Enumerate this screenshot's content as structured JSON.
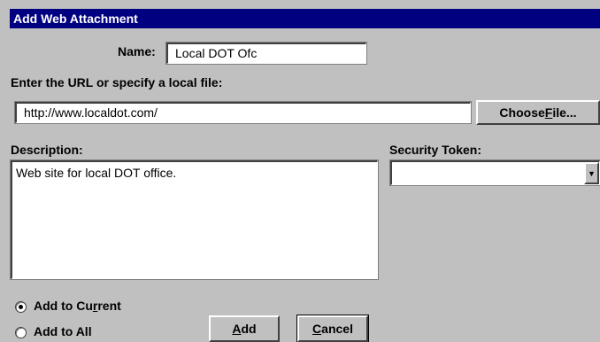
{
  "dialog": {
    "title": "Add Web Attachment"
  },
  "name": {
    "label": "Name:",
    "value": "Local DOT Ofc"
  },
  "url": {
    "label": "Enter the URL or specify a local file:",
    "value": "http://www.localdot.com/",
    "choose_file_pre": "Choose ",
    "choose_file_mnemonic": "F",
    "choose_file_post": "ile..."
  },
  "description": {
    "label": "Description:",
    "value": "Web site for local DOT office."
  },
  "security_token": {
    "label": "Security Token:",
    "value": "",
    "dropdown_icon": "triangle-down"
  },
  "options": {
    "add_to_current_pre": "Add to Cu",
    "add_to_current_mnemonic": "r",
    "add_to_current_post": "rent",
    "add_to_all": "Add to All",
    "selected": "add_to_current"
  },
  "buttons": {
    "add_mnemonic": "A",
    "add_post": "dd",
    "cancel_mnemonic": "C",
    "cancel_post": "ancel"
  }
}
